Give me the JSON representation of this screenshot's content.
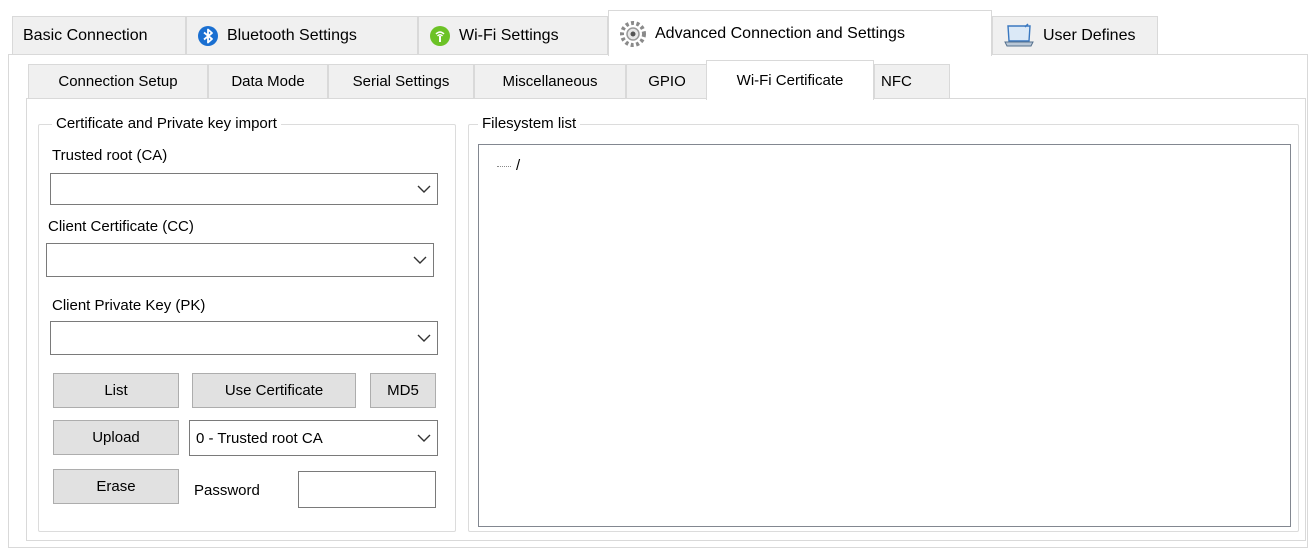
{
  "top_tabs": [
    {
      "label": "Basic Connection",
      "icon": "none",
      "active": false
    },
    {
      "label": "Bluetooth Settings",
      "icon": "bluetooth-icon",
      "active": false
    },
    {
      "label": "Wi-Fi Settings",
      "icon": "wifi-icon",
      "active": false
    },
    {
      "label": "Advanced Connection and Settings",
      "icon": "gear-icon",
      "active": true
    },
    {
      "label": "User Defines",
      "icon": "laptop-icon",
      "active": false
    }
  ],
  "sub_tabs": [
    {
      "label": "Connection Setup",
      "active": false
    },
    {
      "label": "Data Mode",
      "active": false
    },
    {
      "label": "Serial Settings",
      "active": false
    },
    {
      "label": "Miscellaneous",
      "active": false
    },
    {
      "label": "GPIO",
      "active": false
    },
    {
      "label": "Wi-Fi Certificate",
      "active": true
    },
    {
      "label": "NFC",
      "active": false
    }
  ],
  "cert_group": {
    "title": "Certificate and Private key import",
    "trusted_root_label": "Trusted root (CA)",
    "trusted_root_value": "",
    "client_cert_label": "Client Certificate (CC)",
    "client_cert_value": "",
    "client_pk_label": "Client Private Key (PK)",
    "client_pk_value": "",
    "list_button": "List",
    "use_cert_button": "Use Certificate",
    "md5_button": "MD5",
    "upload_button": "Upload",
    "upload_type_value": "0 - Trusted root CA",
    "erase_button": "Erase",
    "password_label": "Password",
    "password_value": ""
  },
  "filesystem": {
    "title": "Filesystem list",
    "tree_root": "/"
  },
  "colors": {
    "tab_inactive": "#f0f0f0",
    "button_face": "#e1e1e1",
    "border": "#d9d9d9"
  }
}
